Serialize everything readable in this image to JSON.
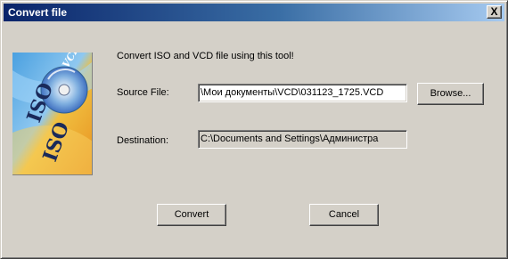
{
  "window": {
    "title": "Convert file",
    "close_label": "X"
  },
  "logo": {
    "text_main": "ISO",
    "text_small": "VCD"
  },
  "content": {
    "description": "Convert  ISO and VCD file using this tool!",
    "source_label": "Source File:",
    "source_value": "\\Мои документы\\VCD\\031123_1725.VCD",
    "destination_label": "Destination:",
    "destination_value": "C:\\Documents and Settings\\Администра"
  },
  "buttons": {
    "browse": "Browse...",
    "convert": "Convert",
    "cancel": "Cancel"
  }
}
